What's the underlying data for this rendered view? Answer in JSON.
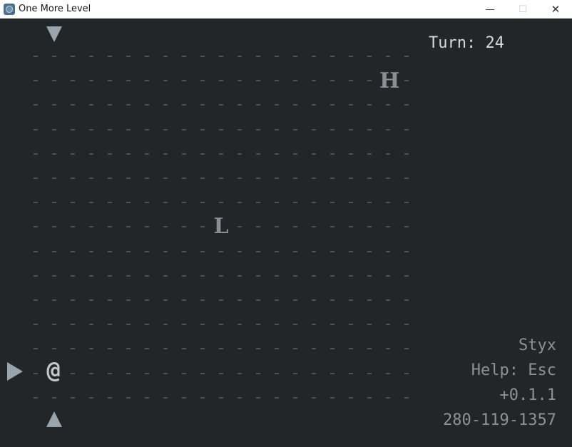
{
  "window": {
    "title": "One More Level",
    "minimize_glyph": "—",
    "maximize_glyph": "☐",
    "close_glyph": "✕",
    "icon": "app-icon"
  },
  "game": {
    "turn_text": "Turn: 24",
    "area_name": "Styx",
    "help_text": "Help: Esc",
    "version": "+0.1.1",
    "seed": "280-119-1357",
    "player_glyph": "@",
    "entities": [
      {
        "glyph": "H",
        "name": "enemy-h"
      },
      {
        "glyph": "L",
        "name": "enemy-l"
      }
    ],
    "indicators": [
      "arrow-down-icon",
      "arrow-up-icon",
      "arrow-right-icon"
    ]
  },
  "colors": {
    "background": "#232629",
    "floor_dot": "#4c5157",
    "entity": "#8a8f95",
    "player": "#c2c7cc",
    "hud_text": "#d4d8dc",
    "hud_dim": "#8d9298"
  }
}
